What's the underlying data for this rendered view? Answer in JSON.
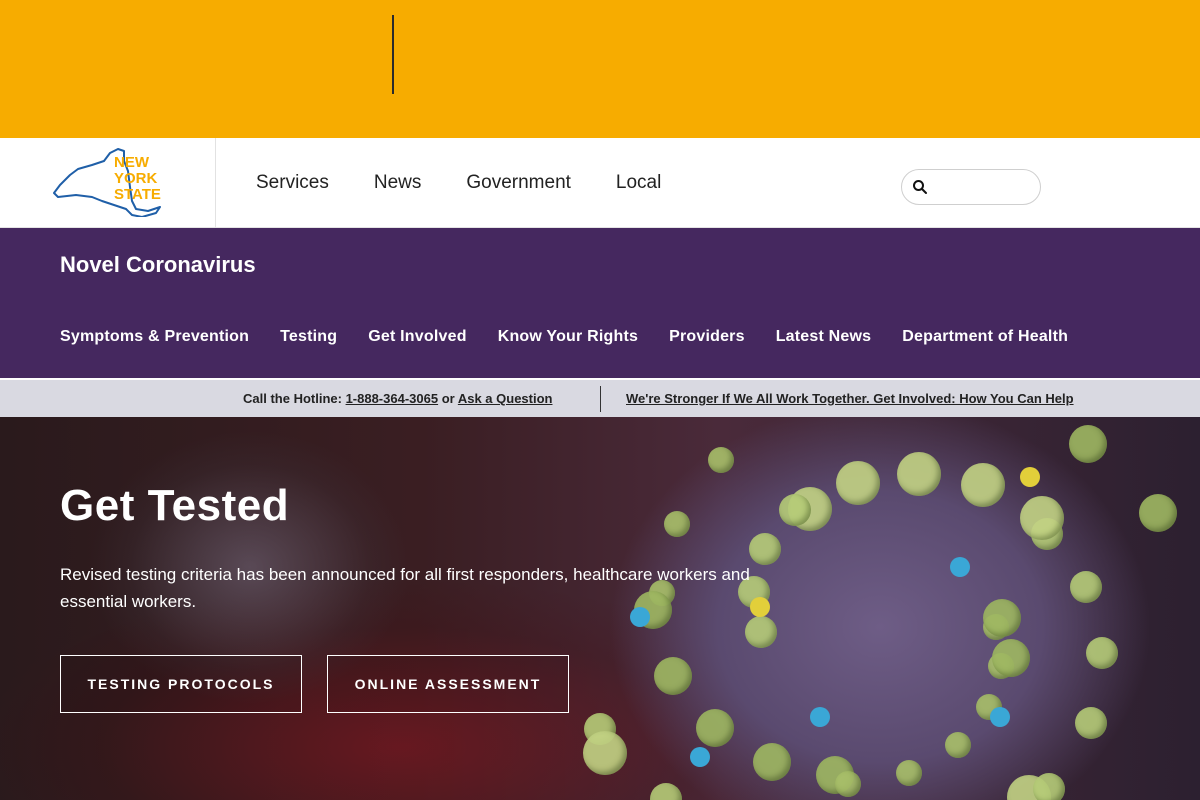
{
  "header": {
    "logo_text": [
      "NEW",
      "YORK",
      "STATE"
    ],
    "nav": [
      "Services",
      "News",
      "Government",
      "Local"
    ],
    "search": {
      "placeholder": "",
      "icon": "search-icon"
    }
  },
  "agency": {
    "title": "Novel Coronavirus",
    "subnav": [
      "Symptoms & Prevention",
      "Testing",
      "Get Involved",
      "Know Your Rights",
      "Providers",
      "Latest News",
      "Department of Health"
    ]
  },
  "hotline": {
    "prefix": "Call the Hotline: ",
    "phone": "1-888-364-3065",
    "or": " or ",
    "ask": "Ask a Question",
    "cta": "We're Stronger If We All Work Together. Get Involved: How You Can Help"
  },
  "hero": {
    "title": "Get Tested",
    "text": "Revised testing criteria has been announced for all first responders, healthcare workers and essential workers.",
    "buttons": [
      "TESTING PROTOCOLS",
      "ONLINE ASSESSMENT"
    ]
  },
  "colors": {
    "banner": "#f7ac00",
    "agency": "#45285f",
    "hotline_bg": "#d9d9e1",
    "logo_blue": "#1f5fa8",
    "logo_gold": "#f7ac00"
  }
}
